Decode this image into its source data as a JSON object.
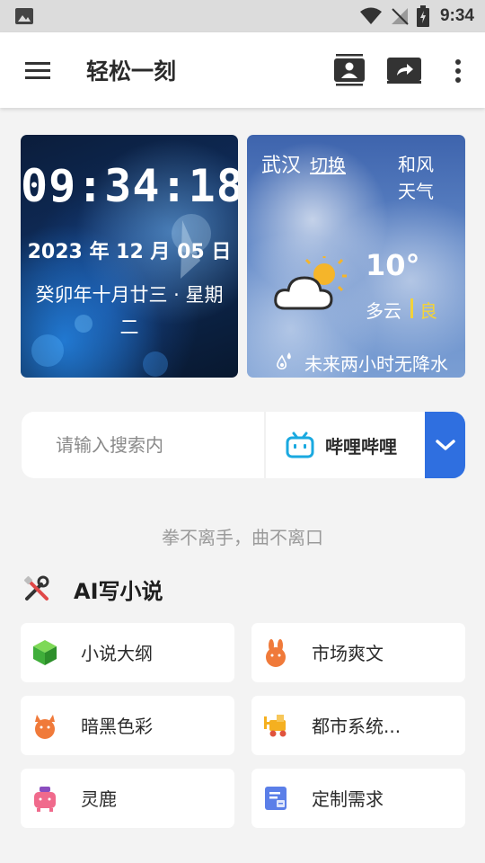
{
  "status_bar": {
    "time": "9:34"
  },
  "app_bar": {
    "title": "轻松一刻"
  },
  "clock_card": {
    "time": "09:34:18",
    "date": "2023 年 12 月 05 日",
    "lunar": "癸卯年十月廿三 · 星期二"
  },
  "weather_card": {
    "city": "武汉",
    "switch_label": "切换",
    "wind_line1": "和风",
    "wind_line2": "天气",
    "temperature": "10°",
    "condition": "多云",
    "air_quality": "良",
    "rain_forecast": "未来两小时无降水"
  },
  "search": {
    "placeholder": "请输入搜索内",
    "engine": "哔哩哔哩"
  },
  "slogan": "拳不离手，曲不离口",
  "section": {
    "title": "AI写小说"
  },
  "tiles": [
    {
      "label": "小说大纲",
      "icon": "green-cube-icon",
      "color": "#4caf50"
    },
    {
      "label": "市场爽文",
      "icon": "orange-bunny-icon",
      "color": "#f07a3a"
    },
    {
      "label": "暗黑色彩",
      "icon": "orange-creature-icon",
      "color": "#f07a3a"
    },
    {
      "label": "都市系统...",
      "icon": "forklift-icon",
      "color": "#f5b020"
    },
    {
      "label": "灵鹿",
      "icon": "pink-deer-icon",
      "color": "#f06a8c"
    },
    {
      "label": "定制需求",
      "icon": "document-edit-icon",
      "color": "#5b7fe8"
    }
  ]
}
